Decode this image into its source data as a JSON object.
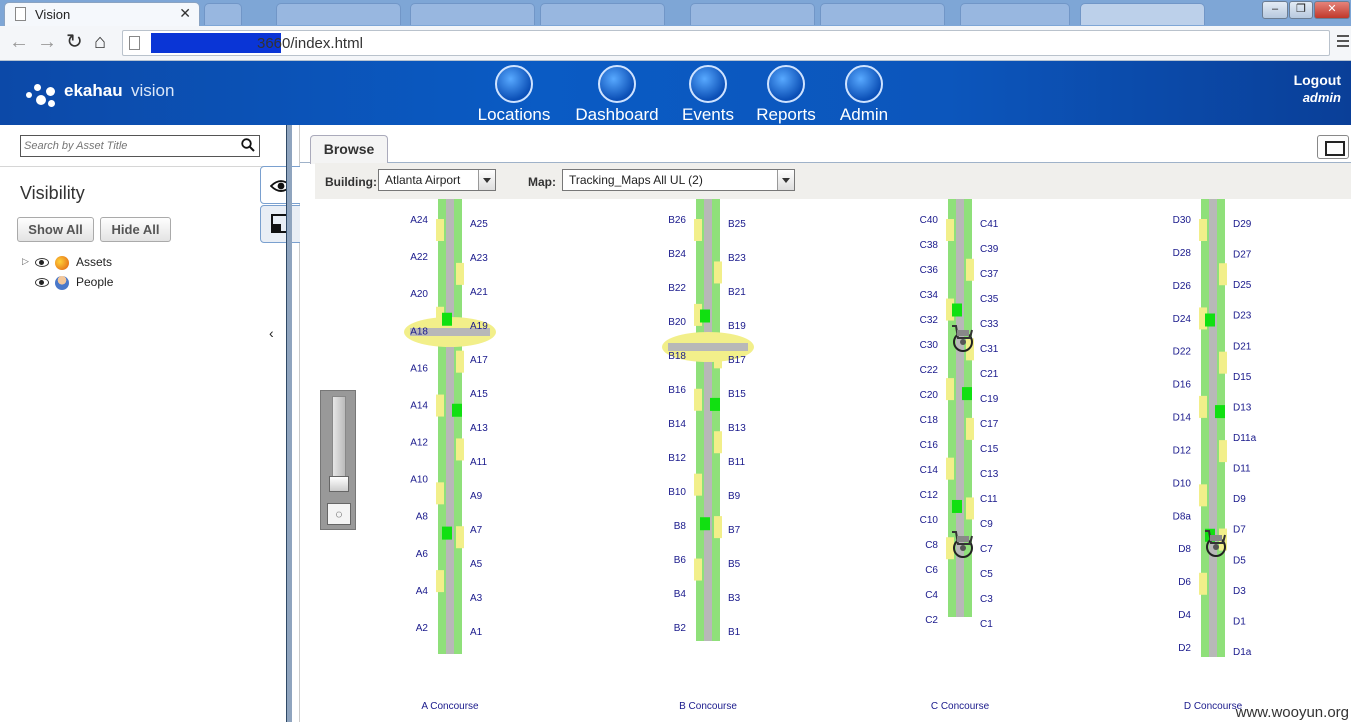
{
  "browser": {
    "tab_title": "Vision",
    "url": "3660/index.html"
  },
  "app": {
    "logo_brand": "ekahau",
    "logo_product": "vision",
    "nav": [
      {
        "label": "Locations",
        "icon": "pin-icon"
      },
      {
        "label": "Dashboard",
        "icon": "gauge-icon"
      },
      {
        "label": "Events",
        "icon": "events-list-icon"
      },
      {
        "label": "Reports",
        "icon": "report-chart-icon"
      },
      {
        "label": "Admin",
        "icon": "user-icon"
      }
    ],
    "logout_label": "Logout",
    "username": "admin"
  },
  "sidebar": {
    "search_placeholder": "Search by Asset Title",
    "visibility_title": "Visibility",
    "show_all": "Show All",
    "hide_all": "Hide All",
    "tree": [
      {
        "label": "Assets",
        "icon": "assets-icon",
        "expandable": true
      },
      {
        "label": "People",
        "icon": "person-icon",
        "expandable": false
      }
    ]
  },
  "main": {
    "tab_browse": "Browse",
    "building_label": "Building:",
    "building_value": "Atlanta Airport",
    "map_label": "Map:",
    "map_value": "Tracking_Maps All UL (2)"
  },
  "map": {
    "concourses": [
      {
        "title": "A Concourse",
        "gates_left": [
          "A24",
          "A22",
          "A20",
          "A18",
          "A16",
          "A14",
          "A12",
          "A10",
          "A8",
          "A6",
          "A4",
          "A2"
        ],
        "gates_right": [
          "A25",
          "A23",
          "A21",
          "A19",
          "A17",
          "A15",
          "A13",
          "A11",
          "A9",
          "A7",
          "A5",
          "A3",
          "A1"
        ]
      },
      {
        "title": "B Concourse",
        "gates_left": [
          "B26",
          "B24",
          "B22",
          "B20",
          "B18",
          "B16",
          "B14",
          "B12",
          "B10",
          "B8",
          "B6",
          "B4",
          "B2"
        ],
        "gates_right": [
          "B25",
          "B23",
          "B21",
          "B19",
          "B17",
          "B15",
          "B13",
          "B11",
          "B9",
          "B7",
          "B5",
          "B3",
          "B1"
        ]
      },
      {
        "title": "C Concourse",
        "gates_left": [
          "C40",
          "C38",
          "C36",
          "C34",
          "C32",
          "C30",
          "C22",
          "C20",
          "C18",
          "C16",
          "C14",
          "C12",
          "C10",
          "C8",
          "C6",
          "C4",
          "C2"
        ],
        "gates_right": [
          "C41",
          "C39",
          "C37",
          "C35",
          "C33",
          "C31",
          "C21",
          "C19",
          "C17",
          "C15",
          "C13",
          "C11",
          "C9",
          "C7",
          "C5",
          "C3",
          "C1"
        ]
      },
      {
        "title": "D Concourse",
        "gates_left": [
          "D30",
          "D28",
          "D26",
          "D24",
          "D22",
          "D16",
          "D14",
          "D12",
          "D10",
          "D8a",
          "D8",
          "D6",
          "D4",
          "D2"
        ],
        "gates_right": [
          "D29",
          "D27",
          "D25",
          "D23",
          "D21",
          "D15",
          "D13",
          "D11a",
          "D11",
          "D9",
          "D7",
          "D5",
          "D3",
          "D1",
          "D1a"
        ]
      }
    ],
    "asset_icon": "wheelchair-icon"
  },
  "watermark": "www.wooyun.org",
  "colors": {
    "header_blue": "#0a5bc4",
    "gate_label": "#1a1a8c",
    "concourse_grey": "#b8b8b8",
    "zone_green": "#8fe07a",
    "zone_yellow": "#f2ef8a",
    "active_zone": "#11e011",
    "redaction": "#0a35d6"
  }
}
